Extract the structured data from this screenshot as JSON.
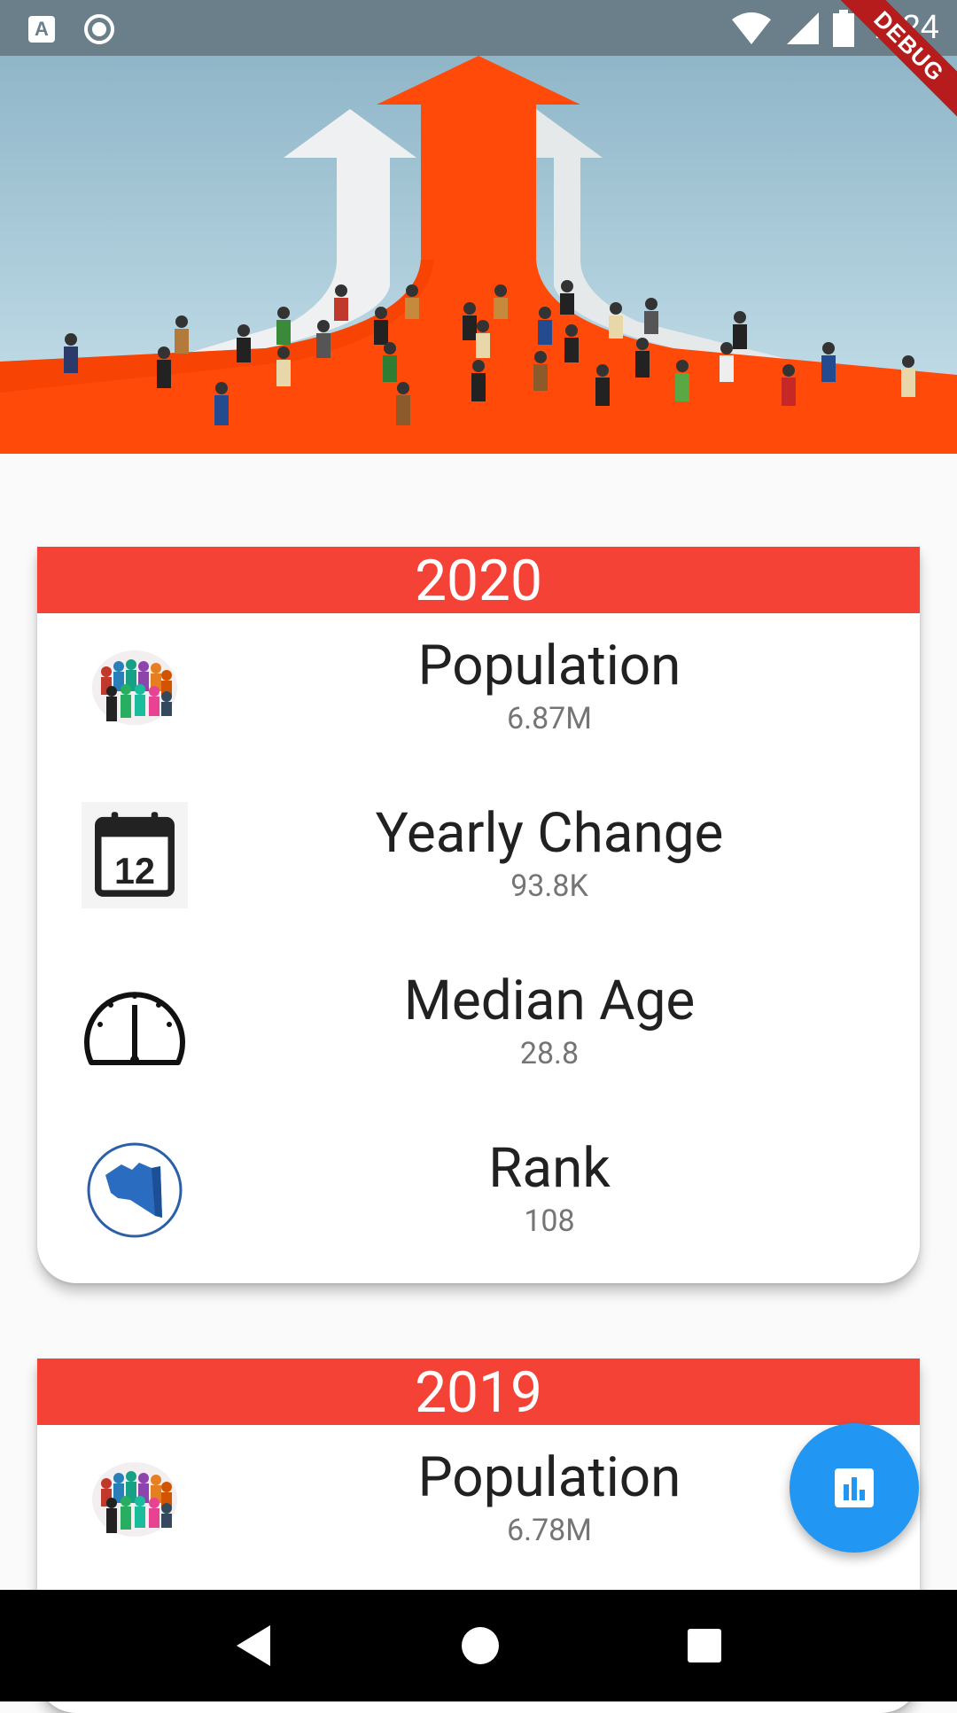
{
  "status_bar": {
    "time": "1:24",
    "left_icons": [
      "a-notification-icon",
      "circle-notification-icon"
    ],
    "right_icons": [
      "wifi-icon",
      "signal-icon",
      "battery-icon"
    ],
    "debug_label": "DEBUG"
  },
  "hero": {
    "image": "population-growth-arrows-crowd-image"
  },
  "cards": [
    {
      "year": "2020",
      "stats": [
        {
          "icon": "crowd-icon",
          "title": "Population",
          "value": "6.87M"
        },
        {
          "icon": "calendar-icon",
          "icon_text": "12",
          "title": "Yearly Change",
          "value": "93.8K"
        },
        {
          "icon": "gauge-icon",
          "title": "Median Age",
          "value": "28.8"
        },
        {
          "icon": "country-map-icon",
          "title": "Rank",
          "value": "108"
        }
      ]
    },
    {
      "year": "2019",
      "stats": [
        {
          "icon": "crowd-icon",
          "title": "Population",
          "value": "6.78M"
        }
      ]
    }
  ],
  "fab": {
    "icon": "bar-chart-icon"
  },
  "nav_bar": {
    "icons": [
      "back-icon",
      "home-icon",
      "recents-icon"
    ]
  },
  "colors": {
    "header_red": "#f44336",
    "fab_blue": "#2196f3",
    "status_bar": "#6a7f8a",
    "hero_orange": "#ff4a0a"
  }
}
